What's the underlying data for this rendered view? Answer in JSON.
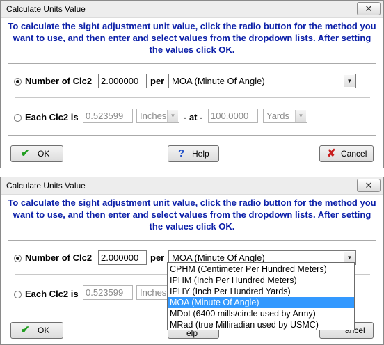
{
  "dialog": {
    "title": "Calculate Units Value",
    "close_glyph": "✕",
    "instructions": "To calculate the sight adjustment unit value, click the radio button for the method you want to use, and then enter and select values from the dropdown lists.  After setting the values click OK.",
    "option1": {
      "label": "Number of Clc2",
      "value": "2.000000",
      "per_label": "per",
      "unit": "MOA (Minute Of Angle)",
      "selected": true
    },
    "option2": {
      "label": "Each Clc2 is",
      "value": "0.523599",
      "unit": "Inches",
      "at_label": "- at -",
      "distance": "100.0000",
      "distance_unit": "Yards",
      "selected": false
    },
    "buttons": {
      "ok": "OK",
      "help": "Help",
      "cancel": "Cancel",
      "ok_icon": "check-icon",
      "help_icon": "question-icon",
      "cancel_icon": "x-icon"
    },
    "dropdown_options": [
      "CPHM (Centimeter Per Hundred Meters)",
      "IPHM (Inch Per Hundred Meters)",
      "IPHY (Inch Per Hundred Yards)",
      "MOA (Minute Of Angle)",
      "MDot (6400 mills/circle used by Army)",
      "MRad (true Milliradian used by USMC)"
    ],
    "dropdown_selected_index": 3,
    "help_button_partial": "elp",
    "cancel_button_partial": "ancel"
  },
  "colors": {
    "instruction_text": "#0b1fa8",
    "selection_highlight": "#3399ff",
    "ok_check": "#1f9d1f",
    "help_icon": "#2050c8",
    "cancel_x": "#c81e1e"
  }
}
